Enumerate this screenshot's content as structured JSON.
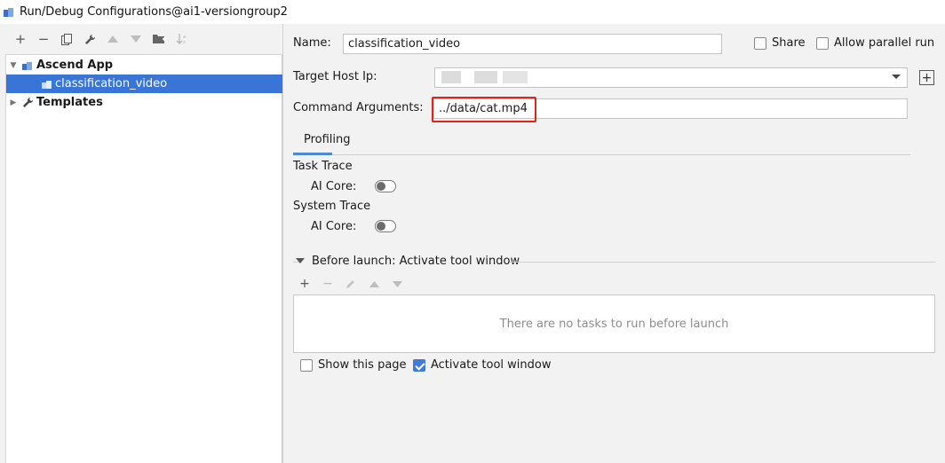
{
  "window": {
    "title": "Run/Debug Configurations@ai1-versiongroup2"
  },
  "left_toolbar": {
    "buttons": [
      {
        "name": "add-icon",
        "glyph": "+",
        "enabled": true
      },
      {
        "name": "remove-icon",
        "glyph": "−",
        "enabled": true
      },
      {
        "name": "copy-icon",
        "glyph": "⧉",
        "enabled": true
      },
      {
        "name": "wrench-icon",
        "glyph": "🔧",
        "enabled": true
      },
      {
        "name": "move-up-icon",
        "glyph": "▲",
        "enabled": false
      },
      {
        "name": "move-down-icon",
        "glyph": "▼",
        "enabled": false
      },
      {
        "name": "folder-icon",
        "glyph": "📁",
        "enabled": true
      },
      {
        "name": "sort-icon",
        "glyph": "↓",
        "enabled": false
      }
    ]
  },
  "tree": {
    "items": [
      {
        "label": "Ascend App",
        "level": 0,
        "expanded": true
      },
      {
        "label": "classification_video",
        "level": 1,
        "selected": true
      },
      {
        "label": "Templates",
        "level": 0,
        "expanded": false
      }
    ]
  },
  "form": {
    "name_label": "Name:",
    "name_value": "classification_video",
    "share_label": "Share",
    "share_checked": false,
    "parallel_label": "Allow parallel run",
    "parallel_checked": false,
    "host_label": "Target Host Ip:",
    "host_value": "",
    "args_label": "Command Arguments:",
    "args_value": "../data/cat.mp4"
  },
  "tabs": [
    {
      "label": "Profiling",
      "active": true
    }
  ],
  "profiling": {
    "task_trace_label": "Task Trace",
    "task_ai_core_label": "AI Core:",
    "task_ai_core_on": false,
    "system_trace_label": "System Trace",
    "system_ai_core_label": "AI Core:",
    "system_ai_core_on": false
  },
  "before_launch": {
    "header": "Before launch: Activate tool window",
    "empty_text": "There are no tasks to run before launch",
    "show_page_label": "Show this page",
    "show_page_checked": false,
    "activate_label": "Activate tool window",
    "activate_checked": true
  },
  "colors": {
    "selection": "#3875d7",
    "highlight": "#e2231a",
    "accent": "#4b8bd1"
  }
}
